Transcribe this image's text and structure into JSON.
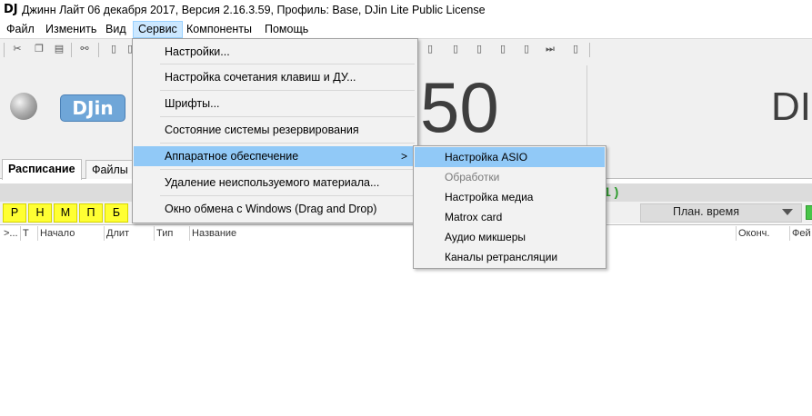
{
  "window": {
    "app_icon": "DJ",
    "title": "Джинн Лайт 06 декабря 2017, Версия 2.16.3.59, Профиль: Base, DJin Lite Public License"
  },
  "menubar": [
    "Файл",
    "Изменить",
    "Вид",
    "Сервис",
    "Компоненты",
    "Помощь"
  ],
  "dropdown": {
    "items": [
      "Настройки...",
      "Настройка сочетания клавиш и ДУ...",
      "Шрифты...",
      "Состояние системы резервирования",
      "Аппаратное обеспечение",
      "Удаление неиспользуемого материала...",
      "Окно обмена с Windows (Drag and Drop)"
    ],
    "submenu_arrow": ">"
  },
  "submenu": {
    "items": [
      "Настройка ASIO",
      "Обработки",
      "Настройка медиа",
      "Matrox card",
      "Аудио микшеры",
      "Каналы ретрансляции"
    ]
  },
  "panel": {
    "logo": "DJin",
    "counter": "50",
    "right_text": "DI"
  },
  "tabs": [
    "Расписание",
    "Файлы"
  ],
  "status": {
    "green_text": "1 )"
  },
  "letters": [
    "Р",
    "Н",
    "М",
    "П",
    "Б"
  ],
  "plan": {
    "label": "План. время"
  },
  "table": {
    "columns": [
      ">...",
      "Т",
      "Начало",
      "Длит",
      "Тип",
      "Название",
      "Оконч.",
      "Фей"
    ]
  },
  "colors": {
    "highlight": "#91c9f7",
    "menu_active": "#cce8ff",
    "letter_buttons": "#ffff33",
    "green_status": "#2a9a2a"
  },
  "icons": [
    "scissors-icon",
    "copy-icon",
    "paste-icon",
    "binoculars-icon",
    "document-icon",
    "skip-end-icon",
    "chevron-down-icon",
    "radio-led-icon"
  ]
}
